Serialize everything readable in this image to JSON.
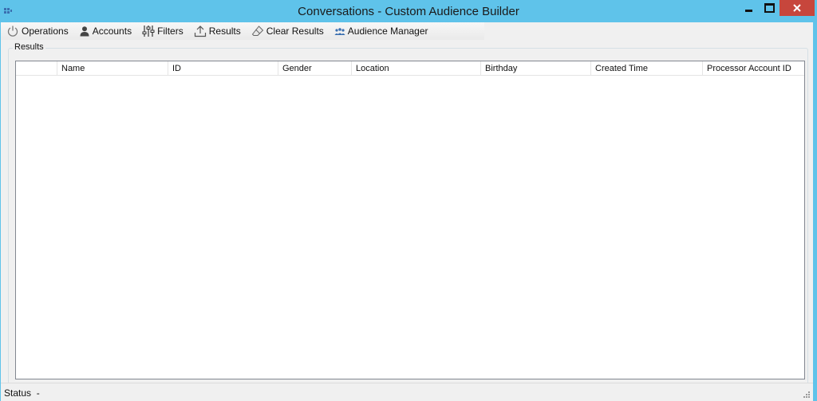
{
  "window": {
    "title": "Conversations - Custom Audience Builder"
  },
  "toolbar": {
    "items": [
      {
        "label": "Operations",
        "icon": "power-icon"
      },
      {
        "label": "Accounts",
        "icon": "user-icon"
      },
      {
        "label": "Filters",
        "icon": "sliders-icon"
      },
      {
        "label": "Results",
        "icon": "upload-icon"
      },
      {
        "label": "Clear Results",
        "icon": "eraser-icon"
      },
      {
        "label": "Audience Manager",
        "icon": "people-icon"
      }
    ]
  },
  "results": {
    "group_label": "Results",
    "columns": [
      "",
      "Name",
      "ID",
      "Gender",
      "Location",
      "Birthday",
      "Created Time",
      "Processor Account ID"
    ],
    "rows": []
  },
  "status": {
    "text": "Status  -"
  },
  "colors": {
    "titlebar": "#5fc3ea",
    "close_button": "#c7463c",
    "client": "#f0f0f0"
  }
}
